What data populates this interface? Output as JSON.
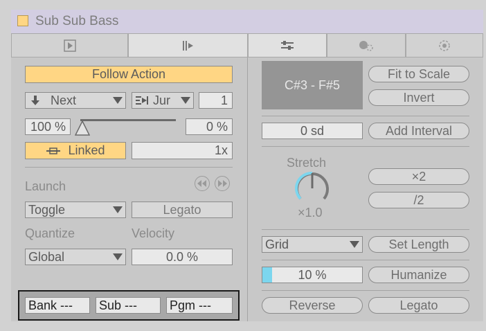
{
  "device": {
    "title": "Sub Sub Bass",
    "accent": "#ffd684"
  },
  "tabs": [
    {
      "icon": "clip-icon"
    },
    {
      "icon": "launch-play-icon"
    },
    {
      "icon": "sliders-icon"
    },
    {
      "icon": "envelope-icon"
    },
    {
      "icon": "settings-dot-icon"
    }
  ],
  "follow_action": {
    "toggle_label": "Follow Action",
    "action_a": "Next",
    "action_b": "Jur",
    "count": "1",
    "chance_a": "100 %",
    "chance_b": "0 %",
    "chance_a_fraction": 1.0,
    "linked_label": "Linked",
    "multiplier": "1x"
  },
  "launch": {
    "launch_label": "Launch",
    "mode": "Toggle",
    "legato_label": "Legato",
    "quantize_label": "Quantize",
    "quantize_value": "Global",
    "velocity_label": "Velocity",
    "velocity_value": "0.0 %"
  },
  "program": {
    "bank": "Bank ---",
    "sub": "Sub ---",
    "pgm": "Pgm ---"
  },
  "pitch": {
    "range": "C#3 - F#5",
    "fit_to_scale": "Fit to Scale",
    "invert": "Invert",
    "interval": "0 sd",
    "add_interval": "Add Interval"
  },
  "stretch": {
    "label": "Stretch",
    "value": "×1.0",
    "double": "×2",
    "half": "/2"
  },
  "length": {
    "grid": "Grid",
    "set_length": "Set Length"
  },
  "humanize": {
    "amount": "10 %",
    "amount_fraction": 0.1,
    "label": "Humanize"
  },
  "actions": {
    "reverse": "Reverse",
    "legato": "Legato"
  }
}
